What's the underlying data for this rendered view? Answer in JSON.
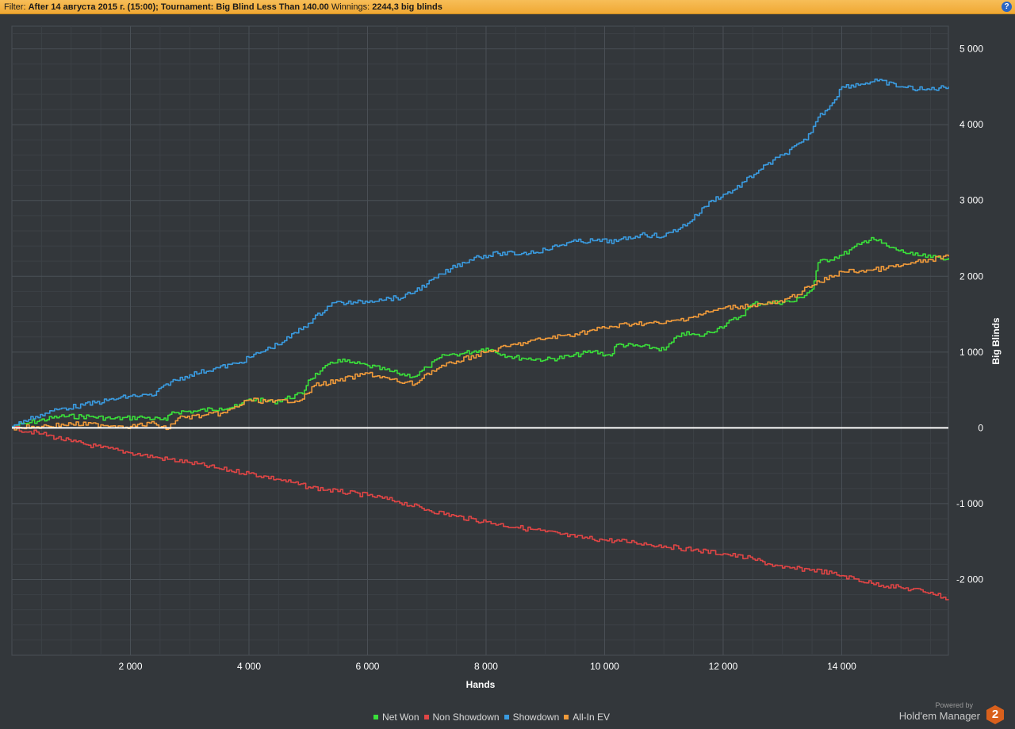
{
  "filter_bar": {
    "label": "Filter:",
    "criteria": "After 14 августа 2015 г. (15:00); Tournament: Big Blind Less Than 140.00",
    "winnings_label": "Winnings:",
    "winnings_value": "2244,3 big blinds",
    "help_icon": "?"
  },
  "chart_data": {
    "type": "line",
    "xlabel": "Hands",
    "ylabel": "Big Blinds",
    "xlim": [
      0,
      15800
    ],
    "ylim": [
      -3000,
      5300
    ],
    "x_ticks": [
      {
        "value": 2000,
        "label": "2 000"
      },
      {
        "value": 4000,
        "label": "4 000"
      },
      {
        "value": 6000,
        "label": "6 000"
      },
      {
        "value": 8000,
        "label": "8 000"
      },
      {
        "value": 10000,
        "label": "10 000"
      },
      {
        "value": 12000,
        "label": "12 000"
      },
      {
        "value": 14000,
        "label": "14 000"
      }
    ],
    "y_ticks": [
      {
        "value": 5000,
        "label": "5 000"
      },
      {
        "value": 4000,
        "label": "4 000"
      },
      {
        "value": 3000,
        "label": "3 000"
      },
      {
        "value": 2000,
        "label": "2 000"
      },
      {
        "value": 1000,
        "label": "1 000"
      },
      {
        "value": 0,
        "label": "0"
      },
      {
        "value": -1000,
        "label": "-1 000"
      },
      {
        "value": -2000,
        "label": "-2 000"
      }
    ],
    "grid": true,
    "legend_position": "bottom-center",
    "series": [
      {
        "name": "Net Won",
        "color": "#3adf3a",
        "x": [
          0,
          300,
          800,
          1300,
          1700,
          2200,
          2500,
          2600,
          2700,
          3100,
          3500,
          3800,
          4000,
          4400,
          4900,
          5000,
          5200,
          5500,
          5700,
          6000,
          6500,
          6800,
          7000,
          7300,
          7600,
          8000,
          8400,
          8600,
          9000,
          9400,
          9800,
          10100,
          10200,
          10800,
          11000,
          11300,
          11600,
          11900,
          12300,
          12500,
          12800,
          13200,
          13500,
          13600,
          14000,
          14300,
          14500,
          14800,
          15200,
          15500,
          15800
        ],
        "y": [
          10,
          70,
          150,
          150,
          120,
          140,
          110,
          100,
          210,
          220,
          260,
          280,
          380,
          340,
          450,
          630,
          750,
          900,
          860,
          820,
          720,
          680,
          800,
          960,
          980,
          1050,
          940,
          920,
          900,
          940,
          1010,
          950,
          1100,
          1060,
          1030,
          1250,
          1210,
          1310,
          1480,
          1640,
          1650,
          1670,
          1830,
          2180,
          2280,
          2420,
          2510,
          2380,
          2280,
          2250,
          2244
        ]
      },
      {
        "name": "Non Showdown",
        "color": "#e04545",
        "x": [
          0,
          500,
          1000,
          1500,
          2000,
          2500,
          3000,
          3500,
          4000,
          4500,
          5000,
          5500,
          6000,
          6500,
          7000,
          7500,
          8000,
          8500,
          9000,
          9500,
          10000,
          10500,
          11000,
          11500,
          12000,
          12500,
          13000,
          13500,
          14000,
          14500,
          15000,
          15500,
          15800
        ],
        "y": [
          0,
          -80,
          -180,
          -260,
          -330,
          -400,
          -460,
          -540,
          -600,
          -680,
          -780,
          -840,
          -890,
          -970,
          -1080,
          -1170,
          -1240,
          -1310,
          -1370,
          -1440,
          -1480,
          -1510,
          -1560,
          -1610,
          -1660,
          -1730,
          -1850,
          -1870,
          -1950,
          -2050,
          -2110,
          -2170,
          -2260
        ]
      },
      {
        "name": "Showdown",
        "color": "#3a9be0",
        "x": [
          0,
          400,
          800,
          1200,
          1600,
          2000,
          2400,
          2600,
          3000,
          3400,
          3800,
          4200,
          4600,
          5000,
          5400,
          5800,
          6200,
          6600,
          7000,
          7400,
          7800,
          8200,
          8600,
          9000,
          9400,
          9800,
          10200,
          10600,
          11000,
          11400,
          11800,
          12200,
          12600,
          13000,
          13400,
          13600,
          13800,
          14000,
          14400,
          14600,
          15000,
          15400,
          15800
        ],
        "y": [
          20,
          150,
          250,
          300,
          360,
          420,
          430,
          580,
          700,
          780,
          850,
          1000,
          1150,
          1380,
          1650,
          1650,
          1700,
          1720,
          1900,
          2100,
          2250,
          2300,
          2300,
          2350,
          2450,
          2470,
          2460,
          2550,
          2530,
          2700,
          3000,
          3150,
          3400,
          3600,
          3800,
          4100,
          4250,
          4500,
          4550,
          4580,
          4500,
          4460,
          4500
        ]
      },
      {
        "name": "All-In EV",
        "color": "#f09a3a",
        "x": [
          0,
          500,
          1000,
          1500,
          2000,
          2400,
          2600,
          2800,
          3200,
          3600,
          4000,
          4400,
          4900,
          5100,
          5500,
          6000,
          6500,
          6800,
          7000,
          7500,
          8000,
          8500,
          9000,
          9500,
          10000,
          10500,
          11000,
          11500,
          12000,
          12500,
          13000,
          13500,
          14000,
          14500,
          15000,
          15500,
          15800
        ],
        "y": [
          0,
          20,
          50,
          40,
          20,
          60,
          -20,
          130,
          160,
          200,
          370,
          340,
          380,
          560,
          620,
          720,
          610,
          580,
          720,
          880,
          1000,
          1100,
          1180,
          1240,
          1320,
          1380,
          1380,
          1470,
          1580,
          1620,
          1660,
          1880,
          2060,
          2080,
          2140,
          2220,
          2260
        ]
      }
    ]
  },
  "legend": [
    "Net Won",
    "Non Showdown",
    "Showdown",
    "All-In EV"
  ],
  "branding": {
    "powered_by": "Powered by",
    "product": "Hold'em Manager",
    "logo_text": "2"
  }
}
